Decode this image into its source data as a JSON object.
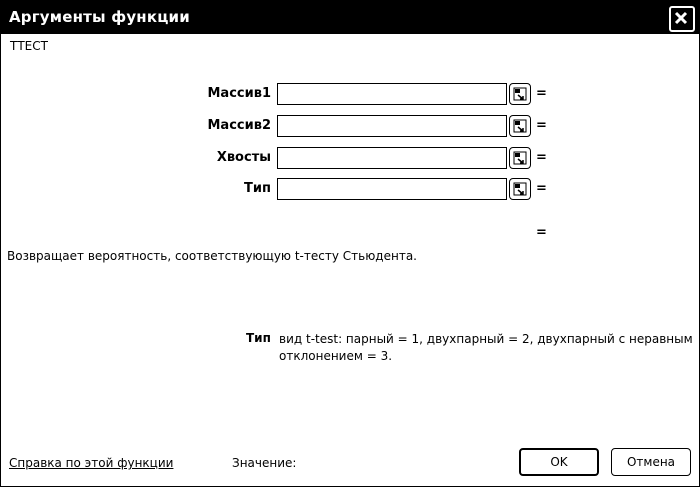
{
  "window": {
    "title": "Аргументы функции"
  },
  "function_name": "ТТЕСТ",
  "arguments": [
    {
      "label": "Массив1",
      "value": ""
    },
    {
      "label": "Массив2",
      "value": ""
    },
    {
      "label": "Хвосты",
      "value": ""
    },
    {
      "label": "Тип",
      "value": ""
    }
  ],
  "equals_sign": "=",
  "description": "Возвращает вероятность, соответствующую t-тесту Стьюдента.",
  "arg_help": {
    "name": "Тип",
    "text": "вид t-test: парный = 1, двухпарный = 2, двухпарный с неравным отклонением = 3."
  },
  "footer": {
    "help_link": "Справка по этой функции",
    "value_label": "Значение:",
    "ok_label": "OK",
    "cancel_label": "Отмена"
  },
  "icons": {
    "close": "close-icon",
    "collapse": "collapse-dialog-icon"
  }
}
